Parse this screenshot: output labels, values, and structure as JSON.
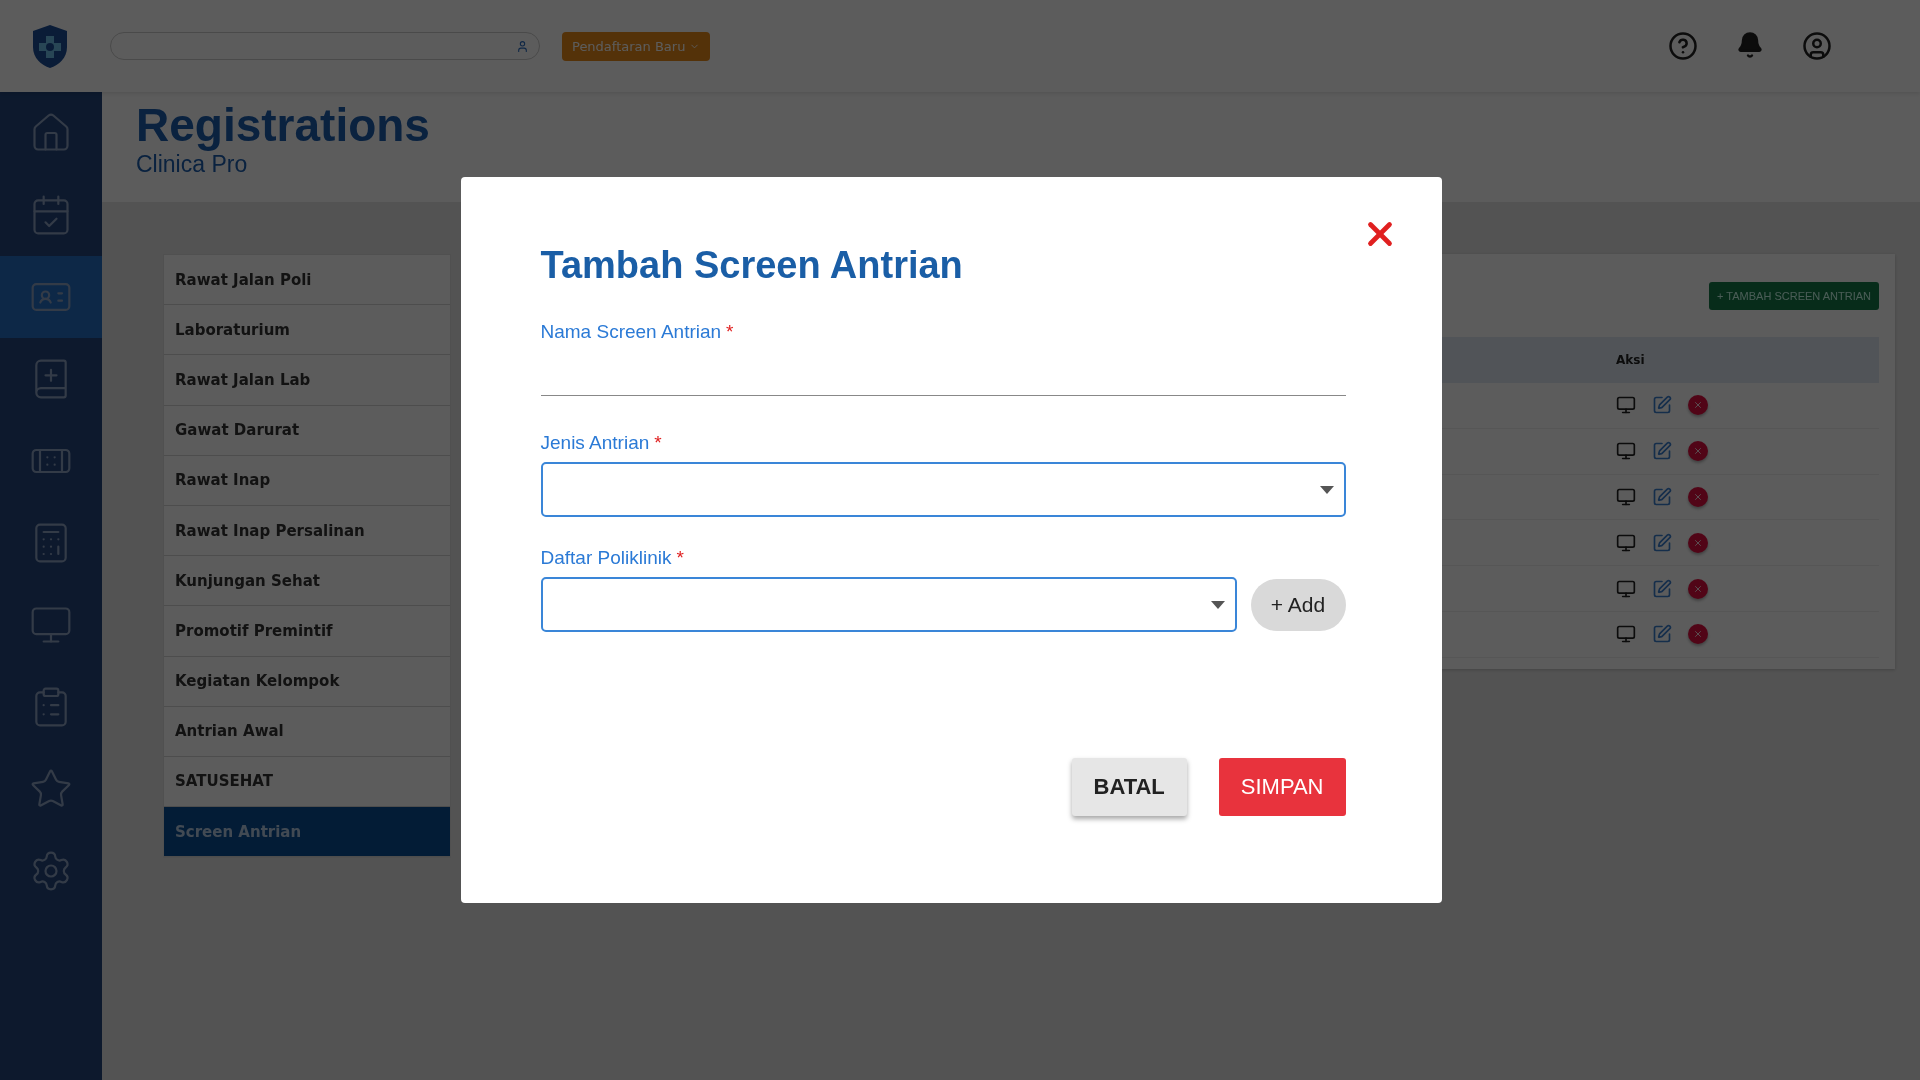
{
  "topbar": {
    "new_registration_button": "Pendaftaran Baru"
  },
  "sidebar": {
    "items": [
      {
        "selected": false
      },
      {
        "selected": false
      },
      {
        "selected": true
      },
      {
        "selected": false
      },
      {
        "selected": false
      },
      {
        "selected": false
      },
      {
        "selected": false
      },
      {
        "selected": false
      },
      {
        "selected": false
      },
      {
        "selected": false
      }
    ]
  },
  "header": {
    "title": "Registrations",
    "subtitle": "Clinica Pro"
  },
  "menu": [
    {
      "label": "Rawat Jalan Poli",
      "selected": false
    },
    {
      "label": "Laboraturium",
      "selected": false
    },
    {
      "label": "Rawat Jalan Lab",
      "selected": false
    },
    {
      "label": "Gawat Darurat",
      "selected": false
    },
    {
      "label": "Rawat Inap",
      "selected": false
    },
    {
      "label": "Rawat Inap Persalinan",
      "selected": false
    },
    {
      "label": "Kunjungan Sehat",
      "selected": false
    },
    {
      "label": "Promotif Premintif",
      "selected": false
    },
    {
      "label": "Kegiatan Kelompok",
      "selected": false
    },
    {
      "label": "Antrian Awal",
      "selected": false
    },
    {
      "label": "SATUSEHAT",
      "selected": false
    },
    {
      "label": "Screen Antrian",
      "selected": true
    }
  ],
  "table": {
    "add_button": "+ TAMBAH SCREEN ANTRIAN",
    "columns": [
      "Aksi"
    ],
    "rows": [
      {
        "kind": "actions"
      },
      {
        "kind": "actions"
      },
      {
        "kind": "actions"
      },
      {
        "kind": "actions"
      },
      {
        "kind": "actions"
      },
      {
        "kind": "actions"
      }
    ]
  },
  "modal": {
    "title": "Tambah Screen Antrian",
    "fields": [
      {
        "kind": "text",
        "label": "Nama Screen Antrian",
        "required_mark": "*"
      },
      {
        "kind": "select",
        "label": "Jenis Antrian",
        "required_mark": "*"
      },
      {
        "kind": "select",
        "label": "Daftar Poliklinik",
        "required_mark": "*",
        "add_button": "+ Add"
      }
    ],
    "buttons": [
      {
        "kind": "secondary",
        "label": "BATAL"
      },
      {
        "kind": "primary",
        "label": "SIMPAN"
      }
    ]
  }
}
